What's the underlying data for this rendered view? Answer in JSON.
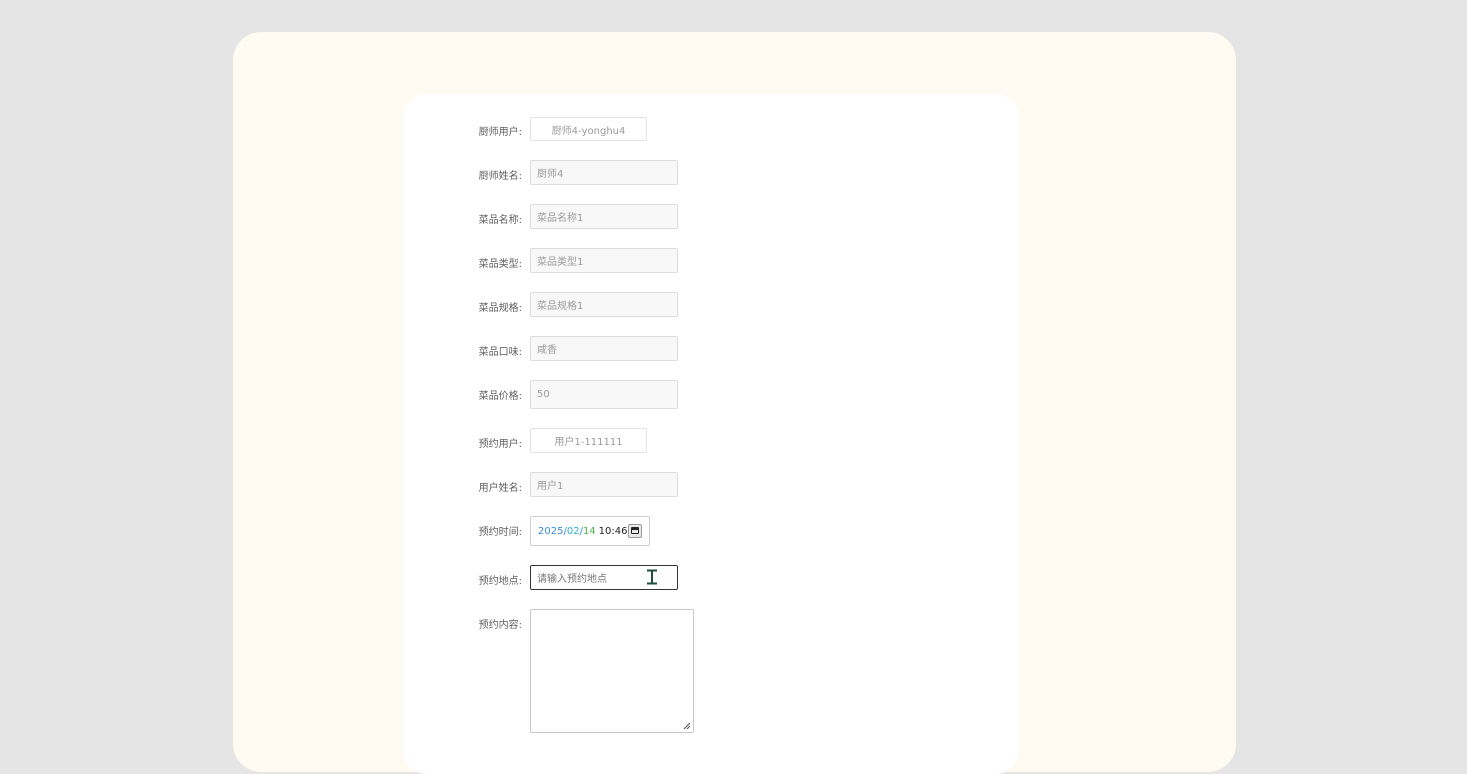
{
  "form": {
    "chef_user": {
      "label": "厨师用户:",
      "value": "厨师4-yonghu4"
    },
    "chef_name": {
      "label": "厨师姓名:",
      "value": "厨师4"
    },
    "dish_name": {
      "label": "菜品名称:",
      "value": "菜品名称1"
    },
    "dish_type": {
      "label": "菜品类型:",
      "value": "菜品类型1"
    },
    "dish_spec": {
      "label": "菜品规格:",
      "value": "菜品规格1"
    },
    "dish_flavor": {
      "label": "菜品口味:",
      "value": "咸香"
    },
    "dish_price": {
      "label": "菜品价格:",
      "value": "50"
    },
    "booking_user": {
      "label": "预约用户:",
      "value": "用户1-111111"
    },
    "user_name": {
      "label": "用户姓名:",
      "value": "用户1"
    },
    "booking_time": {
      "label": "预约时间:",
      "year": "2025",
      "sep1": "/",
      "month": "02",
      "sep2": "/",
      "day": "14",
      "time": "10:46"
    },
    "booking_location": {
      "label": "预约地点:",
      "placeholder": "请输入预约地点"
    },
    "booking_content": {
      "label": "预约内容:",
      "value": ""
    }
  },
  "icons": {
    "calendar": "calendar-icon",
    "text_cursor": "text-cursor-icon",
    "resize": "resize-handle-icon"
  },
  "colors": {
    "page_background": "#e5e5e5",
    "outer_panel": "#fffbf2",
    "form_card": "#ffffff"
  }
}
